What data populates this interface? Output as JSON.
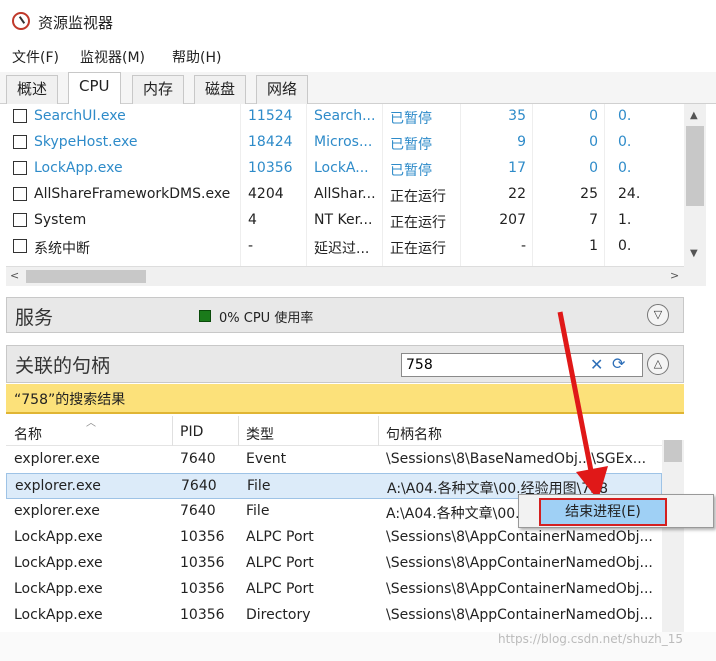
{
  "app": {
    "title": "资源监视器"
  },
  "menu": [
    "文件(F)",
    "监视器(M)",
    "帮助(H)"
  ],
  "tabs": [
    "概述",
    "CPU",
    "内存",
    "磁盘",
    "网络"
  ],
  "active_tab": "CPU",
  "processes": [
    {
      "name": "SearchUI.exe",
      "pid": "11524",
      "desc": "Search...",
      "status": "已暂停",
      "threads": "35",
      "cpu": "0",
      "avg": "0.",
      "suspended": true
    },
    {
      "name": "SkypeHost.exe",
      "pid": "18424",
      "desc": "Micros...",
      "status": "已暂停",
      "threads": "9",
      "cpu": "0",
      "avg": "0.",
      "suspended": true
    },
    {
      "name": "LockApp.exe",
      "pid": "10356",
      "desc": "LockA...",
      "status": "已暂停",
      "threads": "17",
      "cpu": "0",
      "avg": "0.",
      "suspended": true
    },
    {
      "name": "AllShareFrameworkDMS.exe",
      "pid": "4204",
      "desc": "AllShar...",
      "status": "正在运行",
      "threads": "22",
      "cpu": "25",
      "avg": "24.",
      "suspended": false
    },
    {
      "name": "System",
      "pid": "4",
      "desc": "NT Ker...",
      "status": "正在运行",
      "threads": "207",
      "cpu": "7",
      "avg": "1.",
      "suspended": false
    },
    {
      "name": "系统中断",
      "pid": "-",
      "desc": "延迟过...",
      "status": "正在运行",
      "threads": "-",
      "cpu": "1",
      "avg": "0.",
      "suspended": false
    }
  ],
  "services": {
    "title": "服务",
    "cpu_usage": "0% CPU 使用率"
  },
  "handles": {
    "title": "关联的句柄",
    "search_value": "758",
    "results_label": "“758”的搜索结果",
    "columns": [
      "名称",
      "PID",
      "类型",
      "句柄名称"
    ],
    "rows": [
      {
        "name": "explorer.exe",
        "pid": "7640",
        "type": "Event",
        "handle": "\\Sessions\\8\\BaseNamedObj...\\SGEx..."
      },
      {
        "name": "explorer.exe",
        "pid": "7640",
        "type": "File",
        "handle": "A:\\A04.各种文章\\00.经验用图\\758"
      },
      {
        "name": "explorer.exe",
        "pid": "7640",
        "type": "File",
        "handle": "A:\\A04.各种文章\\00.经"
      },
      {
        "name": "LockApp.exe",
        "pid": "10356",
        "type": "ALPC Port",
        "handle": "\\Sessions\\8\\AppContainerNamedObj..."
      },
      {
        "name": "LockApp.exe",
        "pid": "10356",
        "type": "ALPC Port",
        "handle": "\\Sessions\\8\\AppContainerNamedObj..."
      },
      {
        "name": "LockApp.exe",
        "pid": "10356",
        "type": "ALPC Port",
        "handle": "\\Sessions\\8\\AppContainerNamedObj..."
      },
      {
        "name": "LockApp.exe",
        "pid": "10356",
        "type": "Directory",
        "handle": "\\Sessions\\8\\AppContainerNamedObj..."
      }
    ],
    "selected_row": 1
  },
  "context_menu": {
    "item": "结束进程(E)"
  },
  "watermark": "https://blog.csdn.net/shuzh_15",
  "colors": {
    "accent_blue": "#2e8bc9",
    "results_yellow": "#fce17a",
    "highlight_red": "#d42020"
  }
}
